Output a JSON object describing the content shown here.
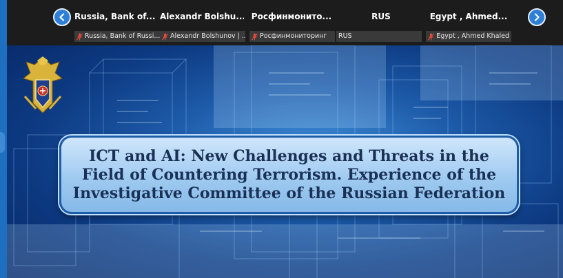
{
  "colors": {
    "topbar": "#1c1c1c",
    "tile_label_bg": "#3a3a3a",
    "nav_button": "#2e7fd8",
    "muted_mic": "#e34b3b",
    "slide_bg": "#0d3a82",
    "title_box": "#9fcaf0",
    "title_text": "#1a3156"
  },
  "participants_strip": {
    "prev_icon": "chevron-left-icon",
    "next_icon": "chevron-right-icon",
    "participants": [
      {
        "name": "Russia, Bank of...",
        "label": "Russia, Bank of Russi...",
        "muted": true
      },
      {
        "name": "Alexandr  Bolshu...",
        "label": "Alexandr Bolshunov | ...",
        "muted": true
      },
      {
        "name": "Росфинмонито...",
        "label": "Росфинмониторинг",
        "muted": true
      },
      {
        "name": "RUS",
        "label": "RUS",
        "muted": false
      },
      {
        "name": "Egypt , Ahmed...",
        "label": "Egypt , Ahmed Khaled",
        "muted": true
      }
    ]
  },
  "slide": {
    "emblem": "investigative-committee-emblem",
    "title": "ICT and AI: New Challenges and Threats in the Field of Countering Terrorism. Experience of the Investigative Committee of the Russian Federation"
  }
}
